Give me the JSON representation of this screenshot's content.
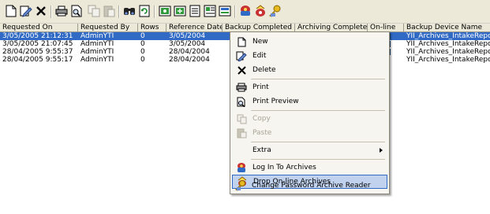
{
  "toolbar": {
    "buttons": [
      {
        "icon": "new-icon"
      },
      {
        "icon": "edit-icon"
      },
      {
        "icon": "delete-icon"
      },
      {
        "icon": "print-icon"
      },
      {
        "icon": "print-preview-icon"
      },
      {
        "icon": "copy-icon"
      },
      {
        "icon": "paste-icon"
      },
      {
        "icon": "find-icon"
      },
      {
        "icon": "refresh-icon"
      },
      {
        "icon": "view-icon-1"
      },
      {
        "icon": "view-icon-2"
      },
      {
        "icon": "view-icon-3"
      },
      {
        "icon": "view-icon-4"
      },
      {
        "icon": "view-icon-5"
      },
      {
        "icon": "log-in-archives-icon"
      },
      {
        "icon": "drop-archives-icon"
      },
      {
        "icon": "change-password-icon"
      }
    ]
  },
  "grid": {
    "columns": [
      "Requested On",
      "Requested By",
      "Rows",
      "Reference Date",
      "Backup Completed",
      "Archiving Completed",
      "On-line",
      "Backup Device Name"
    ],
    "rows": [
      {
        "requested_on": "3/05/2005 21:12:31",
        "requested_by": "AdminYTI",
        "rows": "0",
        "reference_date": "3/05/2004",
        "device": "YII_Archives_IntakeRepo",
        "selected": true
      },
      {
        "requested_on": "3/05/2005 21:07:45",
        "requested_by": "AdminYTI",
        "rows": "0",
        "reference_date": "3/05/2004",
        "device": "YII_Archives_IntakeRepo",
        "selected": false
      },
      {
        "requested_on": "28/04/2005 9:55:37",
        "requested_by": "AdminYTI",
        "rows": "0",
        "reference_date": "28/04/2004",
        "device": "YII_Archives_IntakeRepo",
        "selected": false
      },
      {
        "requested_on": "28/04/2005 9:55:17",
        "requested_by": "AdminYTI",
        "rows": "0",
        "reference_date": "28/04/2004",
        "device": "YII_Archives_IntakeRepo",
        "selected": false
      }
    ]
  },
  "context_menu": {
    "items": [
      {
        "label": "New",
        "icon": "new-icon",
        "enabled": true
      },
      {
        "label": "Edit",
        "icon": "edit-icon",
        "enabled": true
      },
      {
        "label": "Delete",
        "icon": "delete-icon",
        "enabled": true
      },
      {
        "label": "Print",
        "icon": "print-icon",
        "enabled": true
      },
      {
        "label": "Print Preview",
        "icon": "print-preview-icon",
        "enabled": true
      },
      {
        "label": "Copy",
        "icon": "copy-icon",
        "enabled": false
      },
      {
        "label": "Paste",
        "icon": "paste-icon",
        "enabled": false
      },
      {
        "label": "Extra",
        "icon": "",
        "enabled": true,
        "submenu": true
      },
      {
        "label": "Log In To Archives",
        "icon": "log-in-archives-icon",
        "enabled": true
      },
      {
        "label": "Drop On-line Archives",
        "icon": "drop-archives-icon",
        "enabled": true,
        "highlighted": true
      },
      {
        "label": "Change Password Archive Reader",
        "icon": "change-password-icon",
        "enabled": true
      }
    ]
  },
  "colors": {
    "selection": "#316ac5",
    "menu_highlight": "#c1d2ee",
    "toolbar_bg": "#ece9d8"
  }
}
